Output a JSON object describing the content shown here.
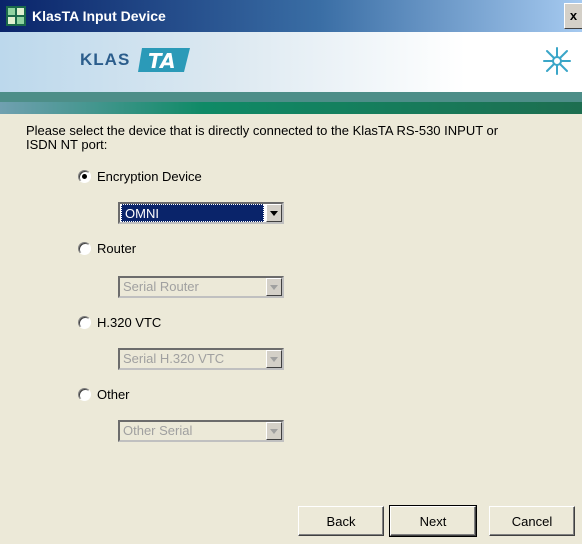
{
  "window": {
    "title": "KlasTA Input Device",
    "close_label": "x",
    "logo": {
      "klas": "KLAS",
      "ta": "TA"
    },
    "banner_icon": "snowflake-icon",
    "title_icon": "app-grid-icon"
  },
  "prompt": "Please select the device that is directly connected to the KlasTA RS-530 INPUT or ISDN NT port:",
  "options": [
    {
      "label": "Encryption Device",
      "checked": true,
      "combo_value": "OMNI",
      "combo_enabled": true
    },
    {
      "label": "Router",
      "checked": false,
      "combo_value": "Serial Router",
      "combo_enabled": false
    },
    {
      "label": "H.320 VTC",
      "checked": false,
      "combo_value": "Serial H.320 VTC",
      "combo_enabled": false
    },
    {
      "label": "Other",
      "checked": false,
      "combo_value": "Other Serial",
      "combo_enabled": false
    }
  ],
  "buttons": {
    "back": "Back",
    "next": "Next",
    "cancel": "Cancel"
  },
  "colors": {
    "title_bar": "#0a246a",
    "dialog_bg": "#ece9d8",
    "teal_band": "#4d8e88",
    "green_band": "#0f8a66",
    "selection": "#0a246a"
  }
}
